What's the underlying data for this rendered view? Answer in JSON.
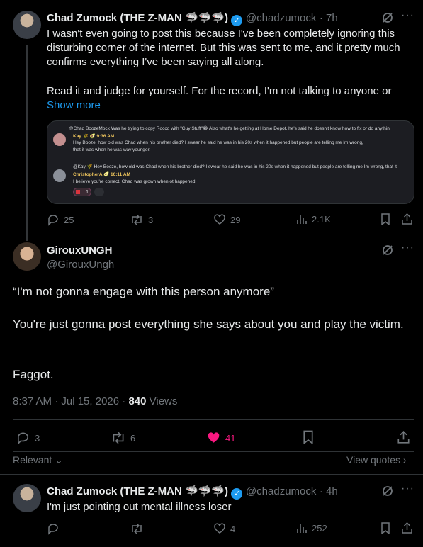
{
  "tweet1": {
    "name": "Chad Zumock (THE Z-MAN 🦈🦈🦈)",
    "handle": "@chadzumock",
    "time": "· 7h",
    "text1": "I wasn't even going to post this because I've been completely ignoring this disturbing corner of the internet. But this was sent to me, and it pretty much confirms everything I've been saying all along.",
    "text2": "Read it and judge for yourself. For the record, I'm not talking to anyone or",
    "show_more": "Show more",
    "embedded": {
      "line1": "@Chad BoozeMock  Was he trying to copy Rocco with \"Guy Stuff\"😂 Also what's he getting at Home Depot, he's said he doesn't know how to fix or do anythin",
      "user1": "Kay 🌾 🥑  9:36 AM",
      "msg1a": "Hey Booze, how old was Chad when his brother died? I swear he said he was in his 20s when it happened but people are telling me Im wrong,",
      "msg1b": "that it was when he was way younger.",
      "reply_ref": "@Kay 🌾 Hey Booze, how old was Chad when his brother died? I swear he said he was in his 20s when it happened but people are telling me Im wrong, that it",
      "user2": "ChristopherA 🥑  10:11 AM",
      "msg2": "I believe you're correct. Chad was grown when ot happened",
      "reaction_count": "1"
    },
    "actions": {
      "replies": "25",
      "reposts": "3",
      "likes": "29",
      "views": "2.1K"
    }
  },
  "tweet2": {
    "name": "GirouxUNGH",
    "handle": "@GirouxUngh",
    "p1": "“I'm not gonna engage with this person anymore”",
    "p2": "You're just gonna post everything she says about you and play the victim.",
    "p3": "Faggot.",
    "timestamp": "8:37 AM · Jul 15, 2026 · ",
    "views_count": "840",
    "views_label": " Views",
    "actions": {
      "replies": "3",
      "reposts": "6",
      "likes": "41"
    }
  },
  "sort": {
    "relevant": "Relevant",
    "view_quotes": "View quotes"
  },
  "tweet3": {
    "name": "Chad Zumock (THE Z-MAN 🦈🦈🦈)",
    "handle": "@chadzumock",
    "time": "· 4h",
    "text": "I'm just pointing out mental illness loser",
    "actions": {
      "likes": "4",
      "views": "252"
    }
  },
  "colors": {
    "accent": "#1d9bf0",
    "like_pink": "#f91880",
    "muted": "#71767b"
  }
}
